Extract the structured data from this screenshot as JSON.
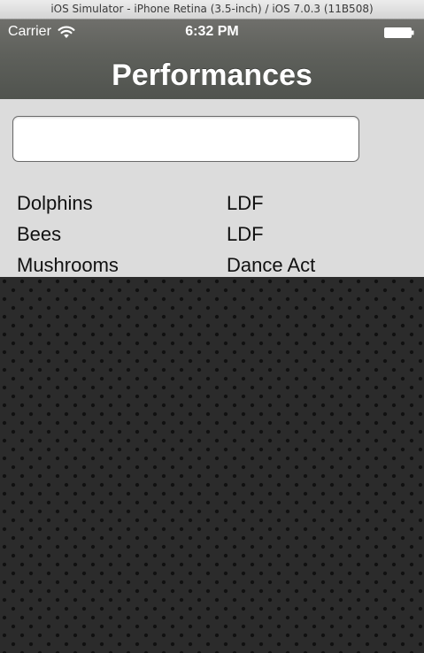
{
  "window": {
    "title": "iOS Simulator - iPhone Retina (3.5-inch) / iOS 7.0.3 (11B508)"
  },
  "status_bar": {
    "carrier": "Carrier",
    "time": "6:32 PM",
    "wifi_icon": "wifi-icon",
    "battery_icon": "battery-icon"
  },
  "nav": {
    "title": "Performances"
  },
  "search": {
    "value": "",
    "placeholder": ""
  },
  "rows": [
    {
      "name": "Dolphins",
      "type": "LDF"
    },
    {
      "name": "Bees",
      "type": "LDF"
    },
    {
      "name": "Mushrooms",
      "type": "Dance Act"
    }
  ],
  "colors": {
    "nav_bar": "#5e605b",
    "content_bg": "#dcdcdc",
    "pattern_bg": "#2b2b2b",
    "text": "#111111"
  }
}
